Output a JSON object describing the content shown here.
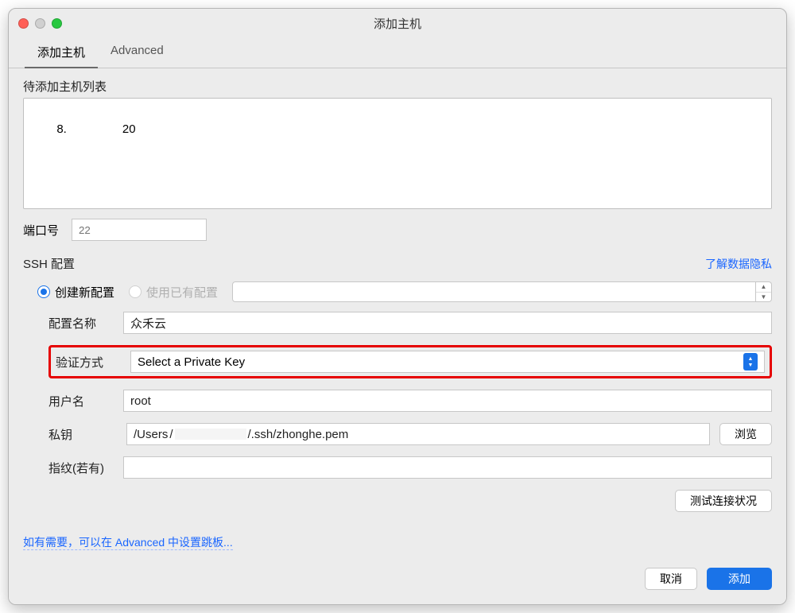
{
  "window": {
    "title": "添加主机"
  },
  "tabs": [
    {
      "label": "添加主机",
      "active": true
    },
    {
      "label": "Advanced",
      "active": false
    }
  ],
  "hostList": {
    "label": "待添加主机列表",
    "items": [
      {
        "prefix": "8.",
        "redacted": true,
        "suffix": "20"
      }
    ]
  },
  "port": {
    "label": "端口号",
    "placeholder": "22"
  },
  "ssh": {
    "sectionLabel": "SSH 配置",
    "privacyLink": "了解数据隐私",
    "options": {
      "createNew": "创建新配置",
      "useExisting": "使用已有配置"
    },
    "fields": {
      "configName": {
        "label": "配置名称",
        "value": "众禾云"
      },
      "authMethod": {
        "label": "验证方式",
        "value": "Select a Private Key"
      },
      "username": {
        "label": "用户名",
        "value": "root"
      },
      "privateKey": {
        "label": "私钥",
        "valuePrefix": "/Users",
        "valueSuffix": "/.ssh/zhonghe.pem"
      },
      "fingerprint": {
        "label": "指纹(若有)",
        "value": ""
      }
    },
    "browseBtn": "浏览",
    "testBtn": "测试连接状况"
  },
  "hint": "如有需要，可以在 Advanced 中设置跳板...",
  "footer": {
    "cancel": "取消",
    "ok": "添加"
  }
}
